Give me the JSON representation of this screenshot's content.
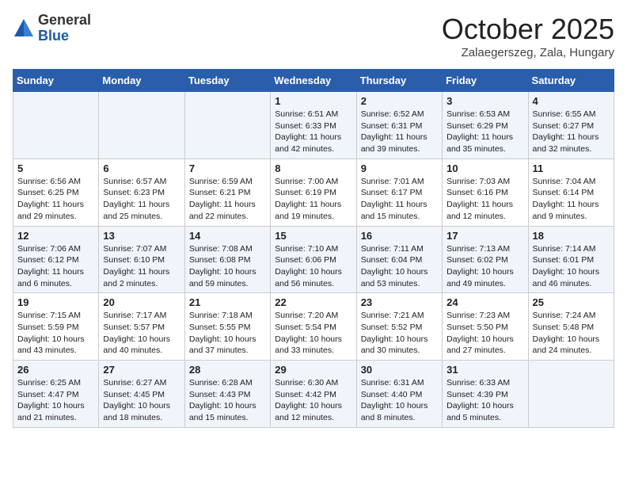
{
  "header": {
    "logo_general": "General",
    "logo_blue": "Blue",
    "month": "October 2025",
    "location": "Zalaegerszeg, Zala, Hungary"
  },
  "columns": [
    "Sunday",
    "Monday",
    "Tuesday",
    "Wednesday",
    "Thursday",
    "Friday",
    "Saturday"
  ],
  "weeks": [
    [
      {
        "day": "",
        "info": ""
      },
      {
        "day": "",
        "info": ""
      },
      {
        "day": "",
        "info": ""
      },
      {
        "day": "1",
        "info": "Sunrise: 6:51 AM\nSunset: 6:33 PM\nDaylight: 11 hours and 42 minutes."
      },
      {
        "day": "2",
        "info": "Sunrise: 6:52 AM\nSunset: 6:31 PM\nDaylight: 11 hours and 39 minutes."
      },
      {
        "day": "3",
        "info": "Sunrise: 6:53 AM\nSunset: 6:29 PM\nDaylight: 11 hours and 35 minutes."
      },
      {
        "day": "4",
        "info": "Sunrise: 6:55 AM\nSunset: 6:27 PM\nDaylight: 11 hours and 32 minutes."
      }
    ],
    [
      {
        "day": "5",
        "info": "Sunrise: 6:56 AM\nSunset: 6:25 PM\nDaylight: 11 hours and 29 minutes."
      },
      {
        "day": "6",
        "info": "Sunrise: 6:57 AM\nSunset: 6:23 PM\nDaylight: 11 hours and 25 minutes."
      },
      {
        "day": "7",
        "info": "Sunrise: 6:59 AM\nSunset: 6:21 PM\nDaylight: 11 hours and 22 minutes."
      },
      {
        "day": "8",
        "info": "Sunrise: 7:00 AM\nSunset: 6:19 PM\nDaylight: 11 hours and 19 minutes."
      },
      {
        "day": "9",
        "info": "Sunrise: 7:01 AM\nSunset: 6:17 PM\nDaylight: 11 hours and 15 minutes."
      },
      {
        "day": "10",
        "info": "Sunrise: 7:03 AM\nSunset: 6:16 PM\nDaylight: 11 hours and 12 minutes."
      },
      {
        "day": "11",
        "info": "Sunrise: 7:04 AM\nSunset: 6:14 PM\nDaylight: 11 hours and 9 minutes."
      }
    ],
    [
      {
        "day": "12",
        "info": "Sunrise: 7:06 AM\nSunset: 6:12 PM\nDaylight: 11 hours and 6 minutes."
      },
      {
        "day": "13",
        "info": "Sunrise: 7:07 AM\nSunset: 6:10 PM\nDaylight: 11 hours and 2 minutes."
      },
      {
        "day": "14",
        "info": "Sunrise: 7:08 AM\nSunset: 6:08 PM\nDaylight: 10 hours and 59 minutes."
      },
      {
        "day": "15",
        "info": "Sunrise: 7:10 AM\nSunset: 6:06 PM\nDaylight: 10 hours and 56 minutes."
      },
      {
        "day": "16",
        "info": "Sunrise: 7:11 AM\nSunset: 6:04 PM\nDaylight: 10 hours and 53 minutes."
      },
      {
        "day": "17",
        "info": "Sunrise: 7:13 AM\nSunset: 6:02 PM\nDaylight: 10 hours and 49 minutes."
      },
      {
        "day": "18",
        "info": "Sunrise: 7:14 AM\nSunset: 6:01 PM\nDaylight: 10 hours and 46 minutes."
      }
    ],
    [
      {
        "day": "19",
        "info": "Sunrise: 7:15 AM\nSunset: 5:59 PM\nDaylight: 10 hours and 43 minutes."
      },
      {
        "day": "20",
        "info": "Sunrise: 7:17 AM\nSunset: 5:57 PM\nDaylight: 10 hours and 40 minutes."
      },
      {
        "day": "21",
        "info": "Sunrise: 7:18 AM\nSunset: 5:55 PM\nDaylight: 10 hours and 37 minutes."
      },
      {
        "day": "22",
        "info": "Sunrise: 7:20 AM\nSunset: 5:54 PM\nDaylight: 10 hours and 33 minutes."
      },
      {
        "day": "23",
        "info": "Sunrise: 7:21 AM\nSunset: 5:52 PM\nDaylight: 10 hours and 30 minutes."
      },
      {
        "day": "24",
        "info": "Sunrise: 7:23 AM\nSunset: 5:50 PM\nDaylight: 10 hours and 27 minutes."
      },
      {
        "day": "25",
        "info": "Sunrise: 7:24 AM\nSunset: 5:48 PM\nDaylight: 10 hours and 24 minutes."
      }
    ],
    [
      {
        "day": "26",
        "info": "Sunrise: 6:25 AM\nSunset: 4:47 PM\nDaylight: 10 hours and 21 minutes."
      },
      {
        "day": "27",
        "info": "Sunrise: 6:27 AM\nSunset: 4:45 PM\nDaylight: 10 hours and 18 minutes."
      },
      {
        "day": "28",
        "info": "Sunrise: 6:28 AM\nSunset: 4:43 PM\nDaylight: 10 hours and 15 minutes."
      },
      {
        "day": "29",
        "info": "Sunrise: 6:30 AM\nSunset: 4:42 PM\nDaylight: 10 hours and 12 minutes."
      },
      {
        "day": "30",
        "info": "Sunrise: 6:31 AM\nSunset: 4:40 PM\nDaylight: 10 hours and 8 minutes."
      },
      {
        "day": "31",
        "info": "Sunrise: 6:33 AM\nSunset: 4:39 PM\nDaylight: 10 hours and 5 minutes."
      },
      {
        "day": "",
        "info": ""
      }
    ]
  ]
}
